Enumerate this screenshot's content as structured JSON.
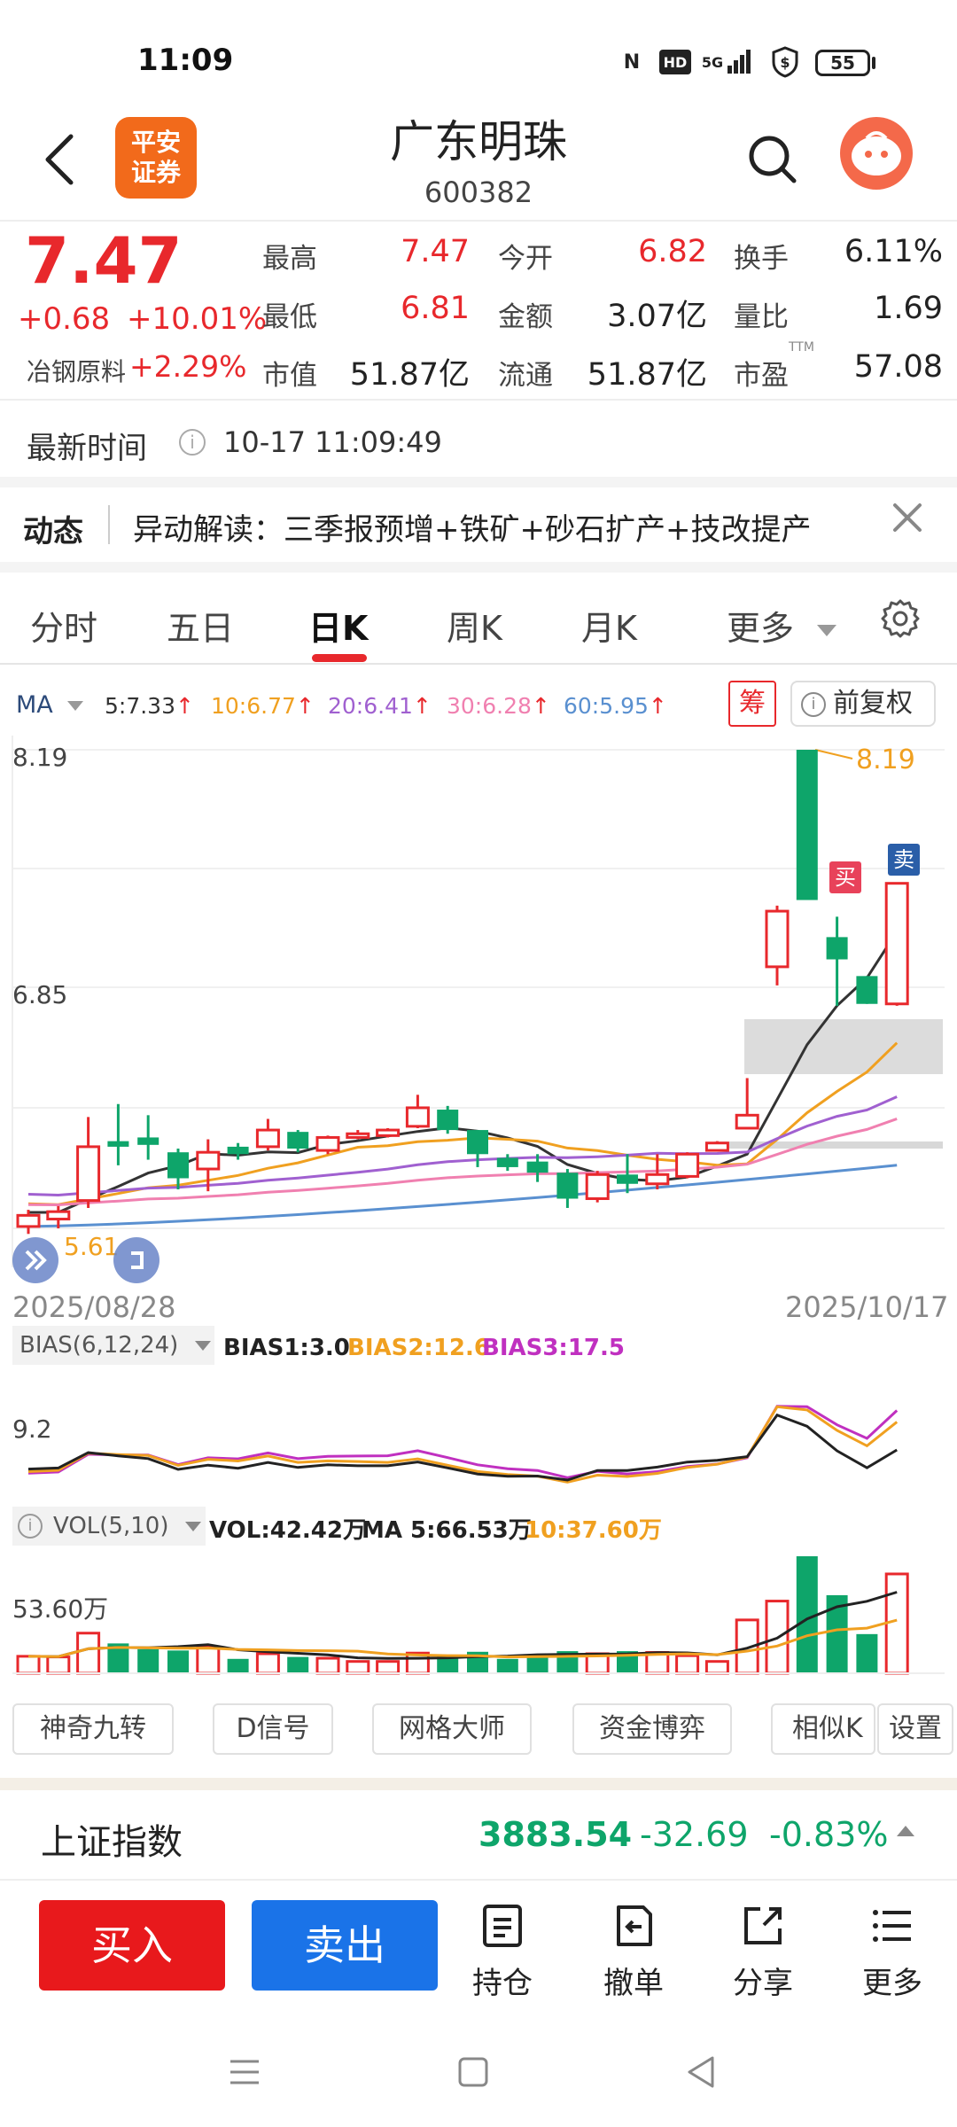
{
  "status": {
    "time": "11:09",
    "nfc": "N",
    "hd": "HD",
    "signal": "5G",
    "battery": "55"
  },
  "header": {
    "broker_logo": "平安证券",
    "stock_name": "广东明珠",
    "stock_code": "600382"
  },
  "quote": {
    "price": "7.47",
    "change": "+0.68",
    "change_pct": "+10.01%",
    "sector_name": "冶钢原料",
    "sector_change": "+2.29%",
    "rows": [
      {
        "label1": "最高",
        "val1": "7.47",
        "label2": "今开",
        "val2": "6.82",
        "label3": "换手",
        "val3": "6.11%"
      },
      {
        "label1": "最低",
        "val1": "6.81",
        "label2": "金额",
        "val2": "3.07亿",
        "label3": "量比",
        "val3": "1.69"
      },
      {
        "label1": "市值",
        "val1": "51.87亿",
        "label2": "流通",
        "val2": "51.87亿",
        "label3": "市盈",
        "val3": "57.08",
        "label3_sup": "TTM"
      }
    ]
  },
  "latest": {
    "label": "最新时间",
    "time": "10-17 11:09:49"
  },
  "dynamic": {
    "label": "动态",
    "text": "异动解读：三季报预增+铁矿+砂石扩产+技改提产"
  },
  "tabs": [
    "分时",
    "五日",
    "日K",
    "周K",
    "月K",
    "更多"
  ],
  "active_tab": "日K",
  "ma": {
    "label": "MA",
    "items": [
      {
        "text": "5:7.33",
        "color": "#333333"
      },
      {
        "text": "10:6.77",
        "color": "#f0a020"
      },
      {
        "text": "20:6.41",
        "color": "#a060d0"
      },
      {
        "text": "30:6.28",
        "color": "#f080b0"
      },
      {
        "text": "60:5.95",
        "color": "#5a90d0"
      }
    ],
    "arrow": "↑",
    "chip_label": "筹",
    "restore_label": "前复权"
  },
  "chart_labels": {
    "y_high": "8.19",
    "y_mid": "6.85",
    "max_marker": "8.19",
    "min_marker": "5.61",
    "date_start": "2025/08/28",
    "date_end": "2025/10/17",
    "buy_marker": "买",
    "sell_marker": "卖"
  },
  "bias": {
    "box": "BIAS(6,12,24)",
    "b1": "BIAS1:3.0",
    "b2": "BIAS2:12.6",
    "b3": "BIAS3:17.5",
    "axis": "9.2"
  },
  "vol": {
    "box": "VOL(5,10)",
    "v": "VOL:42.42万",
    "ma5": "MA 5:66.53万",
    "ma10": "10:37.60万",
    "axis": "53.60万"
  },
  "tools": [
    "神奇九转",
    "D信号",
    "网格大师",
    "资金博弈",
    "相似K",
    "设置"
  ],
  "index": {
    "name": "上证指数",
    "price": "3883.54",
    "change": "-32.69",
    "pct": "-0.83%"
  },
  "actions": {
    "buy": "买入",
    "sell": "卖出",
    "items": [
      "持仓",
      "撤单",
      "分享",
      "更多"
    ]
  },
  "colors": {
    "up": "#e8282c",
    "down": "#0ea56a",
    "buy": "#e8191c",
    "sell": "#1a73e8"
  },
  "chart_data": {
    "type": "candlestick",
    "x_range": [
      "2025/08/28",
      "2025/10/17"
    ],
    "y_ticks": [
      8.19,
      6.85
    ],
    "max_price": 8.19,
    "min_price": 5.61,
    "candles": [
      {
        "o": 5.62,
        "c": 5.68,
        "h": 5.71,
        "l": 5.58,
        "dir": "up"
      },
      {
        "o": 5.66,
        "c": 5.7,
        "h": 5.73,
        "l": 5.61,
        "dir": "up"
      },
      {
        "o": 5.76,
        "c": 6.05,
        "h": 6.21,
        "l": 5.72,
        "dir": "up"
      },
      {
        "o": 6.08,
        "c": 6.05,
        "h": 6.28,
        "l": 5.95,
        "dir": "down"
      },
      {
        "o": 6.1,
        "c": 6.06,
        "h": 6.22,
        "l": 5.98,
        "dir": "down"
      },
      {
        "o": 6.02,
        "c": 5.88,
        "h": 6.04,
        "l": 5.82,
        "dir": "down"
      },
      {
        "o": 5.93,
        "c": 6.02,
        "h": 6.09,
        "l": 5.81,
        "dir": "up"
      },
      {
        "o": 6.05,
        "c": 6.01,
        "h": 6.07,
        "l": 5.98,
        "dir": "down"
      },
      {
        "o": 6.05,
        "c": 6.14,
        "h": 6.2,
        "l": 6.03,
        "dir": "up"
      },
      {
        "o": 6.13,
        "c": 6.04,
        "h": 6.14,
        "l": 6.02,
        "dir": "down"
      },
      {
        "o": 6.03,
        "c": 6.1,
        "h": 6.11,
        "l": 6.01,
        "dir": "up"
      },
      {
        "o": 6.1,
        "c": 6.12,
        "h": 6.14,
        "l": 6.09,
        "dir": "up"
      },
      {
        "o": 6.11,
        "c": 6.14,
        "h": 6.15,
        "l": 6.1,
        "dir": "up"
      },
      {
        "o": 6.16,
        "c": 6.26,
        "h": 6.33,
        "l": 6.15,
        "dir": "up"
      },
      {
        "o": 6.25,
        "c": 6.14,
        "h": 6.27,
        "l": 6.12,
        "dir": "down"
      },
      {
        "o": 6.14,
        "c": 6.01,
        "h": 6.14,
        "l": 5.94,
        "dir": "down"
      },
      {
        "o": 5.99,
        "c": 5.94,
        "h": 6.01,
        "l": 5.92,
        "dir": "down"
      },
      {
        "o": 5.97,
        "c": 5.91,
        "h": 6.01,
        "l": 5.86,
        "dir": "down"
      },
      {
        "o": 5.91,
        "c": 5.77,
        "h": 5.93,
        "l": 5.72,
        "dir": "down"
      },
      {
        "o": 5.77,
        "c": 5.9,
        "h": 5.92,
        "l": 5.75,
        "dir": "up"
      },
      {
        "o": 5.9,
        "c": 5.85,
        "h": 6.01,
        "l": 5.8,
        "dir": "down"
      },
      {
        "o": 5.85,
        "c": 5.9,
        "h": 6.01,
        "l": 5.82,
        "dir": "up"
      },
      {
        "o": 5.89,
        "c": 6.01,
        "h": 6.02,
        "l": 5.88,
        "dir": "up"
      },
      {
        "o": 6.03,
        "c": 6.07,
        "h": 6.08,
        "l": 6.03,
        "dir": "up"
      },
      {
        "o": 6.15,
        "c": 6.22,
        "h": 6.42,
        "l": 6.15,
        "dir": "up"
      },
      {
        "o": 7.02,
        "c": 7.32,
        "h": 7.35,
        "l": 6.92,
        "dir": "up"
      },
      {
        "o": 8.19,
        "c": 7.38,
        "h": 8.19,
        "l": 7.38,
        "dir": "down"
      },
      {
        "o": 7.18,
        "c": 7.06,
        "h": 7.29,
        "l": 6.81,
        "dir": "down"
      },
      {
        "o": 6.97,
        "c": 6.82,
        "h": 6.97,
        "l": 6.82,
        "dir": "down"
      },
      {
        "o": 6.82,
        "c": 7.47,
        "h": 7.47,
        "l": 6.81,
        "dir": "up"
      }
    ],
    "ma_latest": {
      "MA5": 7.33,
      "MA10": 6.77,
      "MA20": 6.41,
      "MA30": 6.28,
      "MA60": 5.95
    },
    "bias_latest": {
      "BIAS1": 3.0,
      "BIAS2": 12.6,
      "BIAS3": 17.5
    },
    "vol_latest": {
      "VOL": "42.42万",
      "MA5": "66.53万",
      "MA10": "37.60万"
    }
  }
}
